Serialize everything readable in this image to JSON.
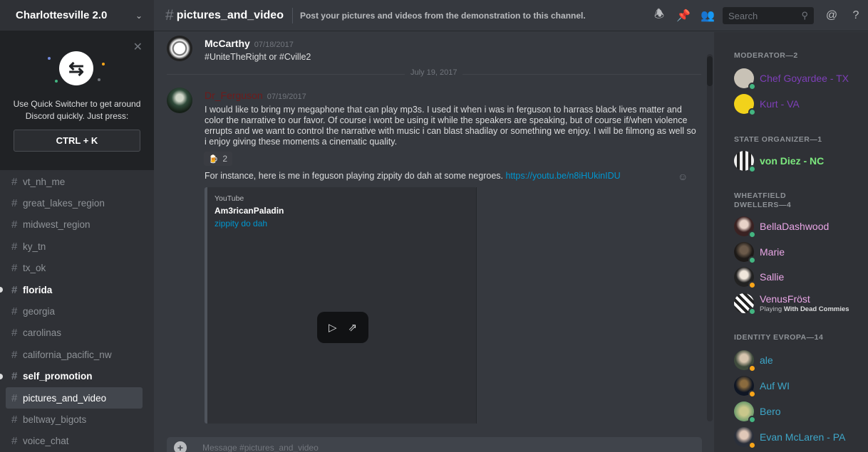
{
  "guild": {
    "name": "Charlottesville 2.0"
  },
  "switcher": {
    "text": "Use Quick Switcher to get around Discord quickly. Just press:",
    "shortcut": "CTRL + K"
  },
  "channels": [
    {
      "name": "vt_nh_me"
    },
    {
      "name": "great_lakes_region"
    },
    {
      "name": "midwest_region"
    },
    {
      "name": "ky_tn"
    },
    {
      "name": "tx_ok"
    },
    {
      "name": "florida"
    },
    {
      "name": "georgia"
    },
    {
      "name": "carolinas"
    },
    {
      "name": "california_pacific_nw"
    },
    {
      "name": "self_promotion"
    },
    {
      "name": "pictures_and_video"
    },
    {
      "name": "beltway_bigots"
    },
    {
      "name": "voice_chat"
    }
  ],
  "header": {
    "channel": "pictures_and_video",
    "topic": "Post your pictures and videos from the demonstration to this channel.",
    "search_placeholder": "Search"
  },
  "messages": {
    "m1": {
      "author": "McCarthy",
      "timestamp": "07/18/2017",
      "text": "#UniteTheRight or #Cville2"
    },
    "date_divider": "July 19, 2017",
    "m2": {
      "author": "Dr_Ferguson",
      "timestamp": "07/19/2017",
      "text": "I would like to bring my megaphone that can play mp3s.  I used it when i was in ferguson to harrass black lives matter and color the narrative to our favor. Of course i wont be using it while the speakers are speaking, but of course if/when violence errupts and we want to control the narrative with music i can blast shadilay or something we enjoy.  I will be filmong as well so i enjoy giving these moments a cinematic quality.",
      "reaction_count": "2",
      "text2": "For instance, here is me in feguson playing zippity do dah at some negroes. ",
      "link": "https://youtu.be/n8iHUkinIDU"
    },
    "embed": {
      "provider": "YouTube",
      "author": "Am3ricanPaladin",
      "title": "zippity do dah"
    }
  },
  "input": {
    "placeholder": "Message #pictures_and_video"
  },
  "members": {
    "roles": {
      "moderator": "MODERATOR—2",
      "state_organizer": "STATE ORGANIZER—1",
      "wheatfield": "WHEATFIELD DWELLERS—4",
      "identity": "IDENTITY EVROPA—14"
    },
    "list": {
      "chef": "Chef Goyardee - TX",
      "kurt": "Kurt - VA",
      "vondiez": "von Diez - NC",
      "bella": "BellaDashwood",
      "marie": "Marie",
      "sallie": "Sallie",
      "venus": "VenusFröst",
      "venus_playing": "Playing",
      "venus_game": "With Dead Commies",
      "ale": "ale",
      "aufwi": "Auf WI",
      "bero": "Bero",
      "evan": "Evan McLaren - PA"
    }
  },
  "colors": {
    "moderator": "#7e3fb8",
    "kurt": "#c9a84a",
    "state_org": "#7ce87e",
    "wheatfield": "#e9a6e6",
    "identity": "#3ea6c8",
    "ferguson": "#6e1b1b"
  }
}
